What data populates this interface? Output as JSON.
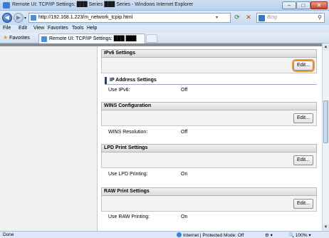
{
  "window": {
    "title": "Remote UI: TCP/IP Settings: ███ Series ███ Series - Windows Internet Explorer"
  },
  "browser": {
    "url": "http://192.168.1.223/m_network_tcpip.html",
    "search_placeholder": "Bing",
    "menu": [
      "File",
      "Edit",
      "View",
      "Favorites",
      "Tools",
      "Help"
    ],
    "favorites_label": "Favorites",
    "tab_label": "Remote UI: TCP/IP Settings: ███ ███"
  },
  "sections": {
    "ipv6": {
      "header": "IPv6 Settings",
      "edit_label": "Edit...",
      "sub_header": "IP Address Settings",
      "row_label": "Use IPv6:",
      "row_value": "Off"
    },
    "wins": {
      "header": "WINS Configuration",
      "edit_label": "Edit...",
      "row_label": "WINS Resolution:",
      "row_value": "Off"
    },
    "lpd": {
      "header": "LPD Print Settings",
      "edit_label": "Edit...",
      "row_label": "Use LPD Printing:",
      "row_value": "On"
    },
    "raw": {
      "header": "RAW Print Settings",
      "edit_label": "Edit...",
      "row_label": "Use RAW Printing:",
      "row_value": "On"
    }
  },
  "status": {
    "left": "Done",
    "zone": "Internet | Protected Mode: Off",
    "zoom": "100%"
  },
  "icons": {
    "back": "back-arrow-icon",
    "forward": "forward-arrow-icon",
    "refresh": "refresh-icon",
    "stop": "stop-icon",
    "search": "search-icon",
    "favorites": "star-icon",
    "zone": "globe-icon"
  },
  "colors": {
    "highlight": "#f39a2e",
    "sub_header_accent": "#1c3f8e"
  }
}
